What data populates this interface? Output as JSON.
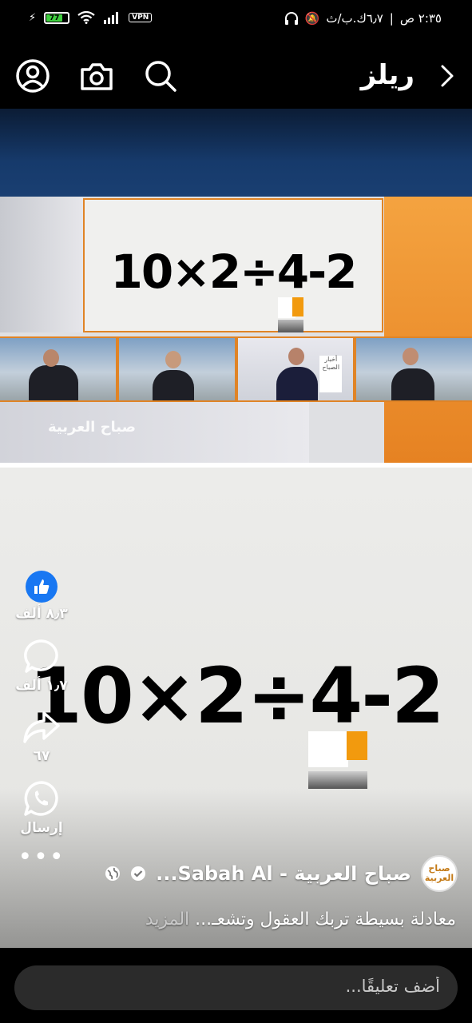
{
  "status_bar": {
    "battery": "77",
    "vpn": "VPN",
    "time": "٢:٣٥ ص",
    "speed": "٦٫٧ك.ب/ث"
  },
  "header": {
    "title": "ريلز"
  },
  "video": {
    "equation": "10×2÷4-2",
    "studio_logo": "صباح العربية",
    "screen_logo": "أخبار الصباح"
  },
  "actions": {
    "likes": "٨٫٣ ألف",
    "comments": "١٫٧ ألف",
    "shares": "٦٧",
    "send": "إرسال"
  },
  "channel": {
    "avatar_text": "صباح العربية",
    "name": "صباح العربية - Sabah Al..."
  },
  "caption": {
    "text": "معادلة بسيطة تربك العقول وتشعـ...",
    "more": "المزيد"
  },
  "comment": {
    "placeholder": "أضف تعليقًا..."
  }
}
